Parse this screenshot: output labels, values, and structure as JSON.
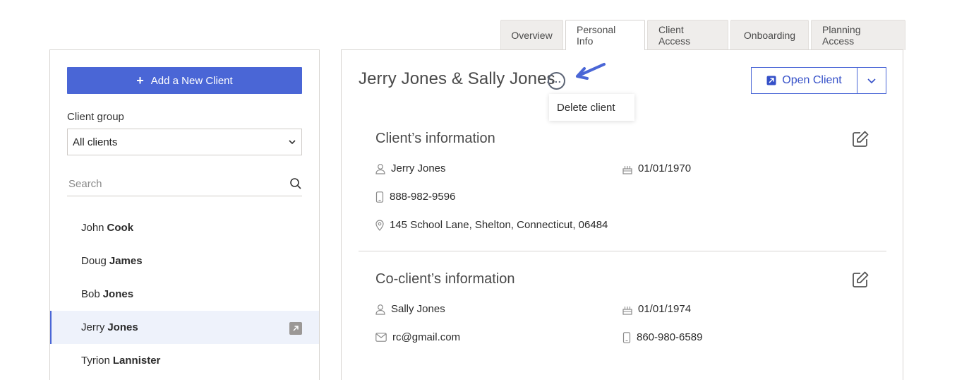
{
  "tabs": [
    {
      "label": "Overview",
      "active": false
    },
    {
      "label": "Personal Info",
      "active": true
    },
    {
      "label": "Client Access",
      "active": false
    },
    {
      "label": "Onboarding",
      "active": false
    },
    {
      "label": "Planning Access",
      "active": false
    }
  ],
  "sidebar": {
    "add_button_label": "Add a New Client",
    "group_label": "Client group",
    "group_value": "All clients",
    "search_placeholder": "Search",
    "clients": [
      {
        "first": "John",
        "last": "Cook",
        "active": false
      },
      {
        "first": "Doug",
        "last": "James",
        "active": false
      },
      {
        "first": "Bob",
        "last": "Jones",
        "active": false
      },
      {
        "first": "Jerry",
        "last": "Jones",
        "active": true
      },
      {
        "first": "Tyrion",
        "last": "Lannister",
        "active": false
      }
    ]
  },
  "main": {
    "title": "Jerry Jones & Sally Jones",
    "more_menu": {
      "items": [
        "Delete client"
      ]
    },
    "open_client_label": "Open Client",
    "client": {
      "heading": "Client’s information",
      "name": "Jerry Jones",
      "dob": "01/01/1970",
      "phone": "888-982-9596",
      "address": "145 School Lane, Shelton, Connecticut, 06484"
    },
    "co_client": {
      "heading": "Co-client’s information",
      "name": "Sally Jones",
      "dob": "01/01/1974",
      "email": "rc@gmail.com",
      "phone": "860-980-6589"
    }
  },
  "colors": {
    "accent": "#4a66d6",
    "arrow": "#4a66d6",
    "active_row": "#eef2fb"
  },
  "icons": [
    "plus-icon",
    "chevron-down-icon",
    "search-icon",
    "open-external-icon",
    "more-horizontal-icon",
    "arrow-icon",
    "edit-icon",
    "user-icon",
    "cake-icon",
    "phone-icon",
    "location-icon",
    "mail-icon"
  ]
}
